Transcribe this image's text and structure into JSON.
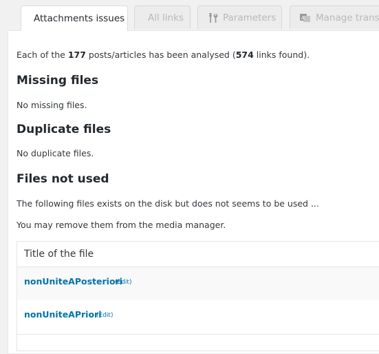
{
  "tabs": [
    {
      "label": "Attachments issues",
      "active": true
    },
    {
      "label": "All links",
      "active": false
    },
    {
      "label": "Parameters",
      "active": false,
      "icon": "tools-icon"
    },
    {
      "label": "Manage translations",
      "active": false,
      "icon": "translate-icon"
    }
  ],
  "summary": {
    "prefix": "Each of the ",
    "posts_count": "177",
    "middle": " posts/articles has been analysed (",
    "links_count": "574",
    "suffix": " links found)."
  },
  "missing": {
    "heading": "Missing files",
    "text": "No missing files."
  },
  "duplicate": {
    "heading": "Duplicate files",
    "text": "No duplicate files."
  },
  "unused": {
    "heading": "Files not used",
    "text1": "The following files exists on the disk but does not seems to be used ...",
    "text2": "You may remove them from the media manager.",
    "column_title": "Title of the file",
    "files": [
      {
        "name": "nonUniteAPosteriori",
        "edit": "(Edit)"
      },
      {
        "name": "nonUniteAPriori",
        "edit": "(Edit)"
      }
    ]
  },
  "colors": {
    "link": "#0073aa",
    "panel_bg": "#ffffff",
    "page_bg": "#f1f1f1",
    "inactive_tab_text": "#b8b8b8"
  }
}
